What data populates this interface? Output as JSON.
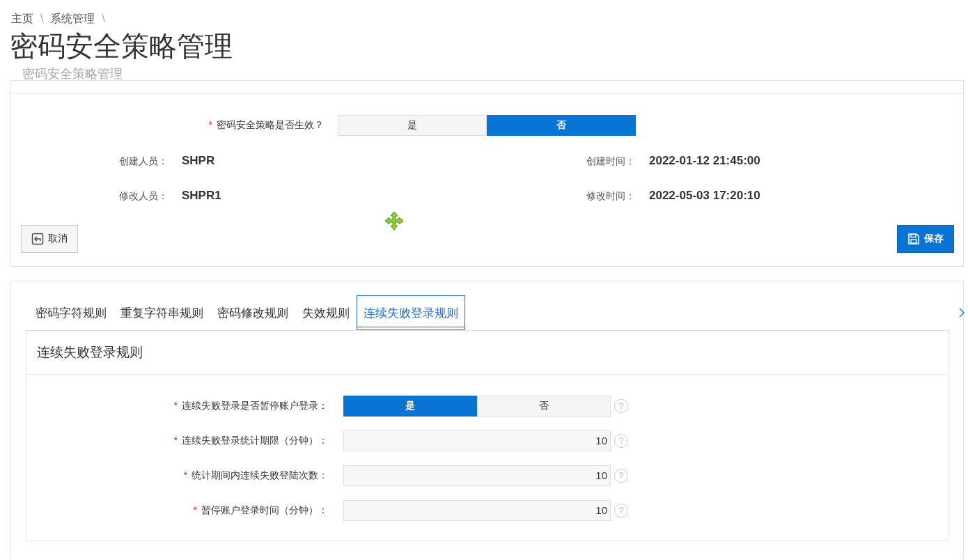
{
  "breadcrumb": [
    {
      "label": "主页",
      "separator": "\\"
    },
    {
      "label": "系统管理",
      "separator": "\\"
    }
  ],
  "page_title": "密码安全策略管理",
  "panel_title": "密码安全策略管理",
  "policy_toggle": {
    "required_mark": "*",
    "label": "密码安全策略是否生效？",
    "options": [
      {
        "label": "是",
        "selected": false
      },
      {
        "label": "否",
        "selected": true
      }
    ]
  },
  "info": [
    {
      "label": "创建人员：",
      "value": "SHPR"
    },
    {
      "label": "创建时间：",
      "value": "2022-01-12 21:45:00"
    },
    {
      "label": "修改人员：",
      "value": "SHPR1"
    },
    {
      "label": "修改时间：",
      "value": "2022-05-03 17:20:10"
    }
  ],
  "buttons": [
    {
      "label": "取消",
      "kind": "cancel"
    },
    {
      "label": "保存",
      "kind": "save"
    }
  ],
  "tabs": [
    {
      "label": "密码字符规则",
      "selected": false
    },
    {
      "label": "重复字符串规则",
      "selected": false
    },
    {
      "label": "密码修改规则",
      "selected": false
    },
    {
      "label": "失效规则",
      "selected": false
    },
    {
      "label": "连续失败登录规则",
      "selected": true
    }
  ],
  "card_title": "连续失败登录规则",
  "fields": [
    {
      "kind": "toggle",
      "required_mark": "*",
      "label": "连续失败登录是否暂停账户登录：",
      "help": "?",
      "options": [
        {
          "label": "是",
          "selected": true
        },
        {
          "label": "否",
          "selected": false
        }
      ]
    },
    {
      "kind": "number",
      "required_mark": "*",
      "label": "连续失败登录统计期限（分钟）：",
      "help": "?",
      "value": "10"
    },
    {
      "kind": "number",
      "required_mark": "*",
      "label": "统计期间内连续失败登陆次数：",
      "help": "?",
      "value": "10"
    },
    {
      "kind": "number",
      "required_mark": "*",
      "label": "暂停账户登录时间（分钟）：",
      "help": "?",
      "value": "10"
    }
  ]
}
